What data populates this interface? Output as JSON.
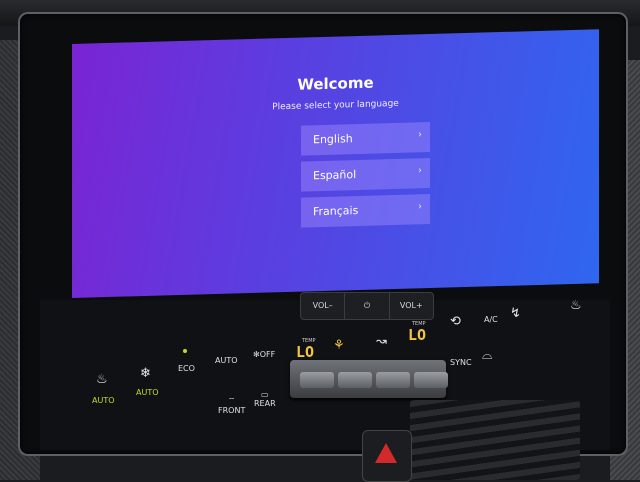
{
  "screen": {
    "title": "Welcome",
    "subtitle": "Please select your language",
    "languages": [
      {
        "label": "English"
      },
      {
        "label": "Español"
      },
      {
        "label": "Français"
      }
    ],
    "chevron": "›",
    "gradient_colors": [
      "#7a24d4",
      "#2f66f0"
    ]
  },
  "top_buttons": {
    "vol_down": "VOL–",
    "power_icon": "⏻",
    "vol_up": "VOL+"
  },
  "climate": {
    "left_seat_heat_label": "AUTO",
    "left_seat_vent_label": "AUTO",
    "eco": "ECO",
    "auto": "AUTO",
    "off": "OFF",
    "temp_label": "TEMP",
    "left_temp": "LO",
    "right_temp": "LO",
    "sync": "SYNC",
    "ac": "A/C",
    "front": "FRONT",
    "rear": "REAR",
    "accent_color": "#b8e020",
    "temp_color": "#f4c542"
  }
}
